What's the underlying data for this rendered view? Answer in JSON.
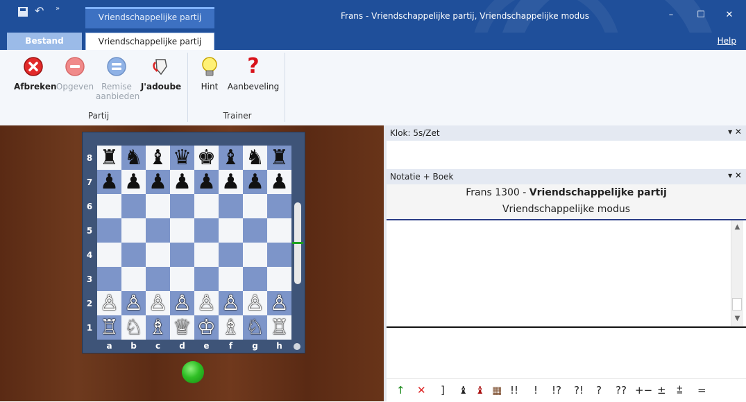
{
  "titlebar": {
    "context_tab": "Vriendschappelijke partij",
    "window_title": "Frans - Vriendschappelijke partij, Vriendschappelijke modus",
    "min": "–",
    "max": "☐",
    "close": "✕"
  },
  "tabs": {
    "file": "Bestand",
    "game": "Vriendschappelijke partij",
    "help": "Help"
  },
  "ribbon": {
    "groups": [
      {
        "label": "Partij",
        "buttons": [
          {
            "label": "Afbreken",
            "icon": "abort-icon",
            "enabled": true
          },
          {
            "label": "Opgeven",
            "icon": "resign-icon",
            "enabled": false
          },
          {
            "label": "Remise aanbieden",
            "icon": "draw-offer-icon",
            "enabled": false
          },
          {
            "label": "J'adoube",
            "icon": "jadoube-icon",
            "enabled": true
          }
        ]
      },
      {
        "label": "Trainer",
        "buttons": [
          {
            "label": "Hint",
            "icon": "lightbulb-icon",
            "enabled": true
          },
          {
            "label": "Aanbeveling",
            "icon": "question-icon",
            "enabled": true
          }
        ]
      }
    ],
    "remise_line1": "Remise",
    "remise_line2": "aanbieden"
  },
  "board": {
    "ranks": [
      "8",
      "7",
      "6",
      "5",
      "4",
      "3",
      "2",
      "1"
    ],
    "files": [
      "a",
      "b",
      "c",
      "d",
      "e",
      "f",
      "g",
      "h"
    ],
    "position": [
      [
        "♜",
        "♞",
        "♝",
        "♛",
        "♚",
        "♝",
        "♞",
        "♜"
      ],
      [
        "♟",
        "♟",
        "♟",
        "♟",
        "♟",
        "♟",
        "♟",
        "♟"
      ],
      [
        "",
        "",
        "",
        "",
        "",
        "",
        "",
        ""
      ],
      [
        "",
        "",
        "",
        "",
        "",
        "",
        "",
        ""
      ],
      [
        "",
        "",
        "",
        "",
        "",
        "",
        "",
        ""
      ],
      [
        "",
        "",
        "",
        "",
        "",
        "",
        "",
        ""
      ],
      [
        "♙",
        "♙",
        "♙",
        "♙",
        "♙",
        "♙",
        "♙",
        "♙"
      ],
      [
        "♖",
        "♘",
        "♗",
        "♕",
        "♔",
        "♗",
        "♘",
        "♖"
      ]
    ]
  },
  "panels": {
    "clock_title": "Klok: 5s/Zet",
    "notation_title": "Notatie + Boek",
    "panel_controls": "▾ ✕",
    "game_title_prefix": "Frans 1300 - ",
    "game_title_bold": "Vriendschappelijke partij",
    "game_mode": "Vriendschappelijke modus"
  },
  "annotations": [
    "↑",
    "✕",
    "]",
    "♝",
    "♝",
    "▦",
    "!!",
    "!",
    "!?",
    "?!",
    "?",
    "??",
    "+−",
    "±",
    "⩲",
    "="
  ],
  "colors": {
    "titlebar": "#1f4f9a",
    "board_dark": "#7d95c9",
    "board_light": "#f4f6f9",
    "turn_indicator": "#2fbf25"
  }
}
